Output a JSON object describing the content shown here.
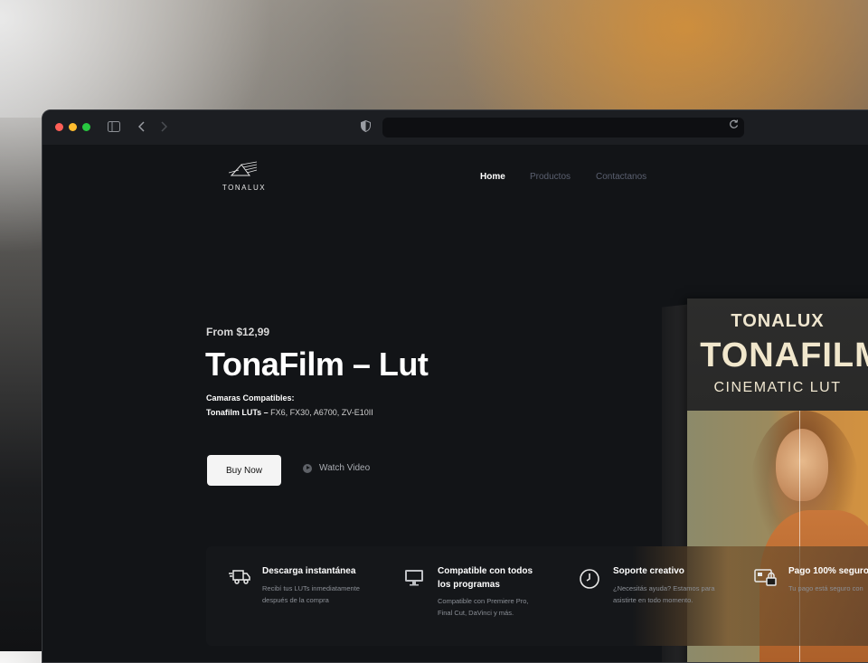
{
  "site": {
    "logo_text": "TONALUX",
    "nav": {
      "home": "Home",
      "products": "Productos",
      "contact": "Contactanos"
    }
  },
  "hero": {
    "price": "From $12,99",
    "title": "TonaFilm – Lut",
    "compat_label": "Camaras Compatibles:",
    "compat_bold": "Tonafilm LUTs –",
    "compat_models": " FX6, FX30, A6700, ZV-E10II",
    "buy_label": "Buy Now",
    "watch_label": "Watch Video"
  },
  "product_box": {
    "brand": "TONALUX",
    "title": "TONAFILM",
    "subtitle": "CINEMATIC LUT"
  },
  "features": [
    {
      "icon": "delivery-truck-icon",
      "title": "Descarga instantánea",
      "desc1": "Recibí tus LUTs inmediatamente",
      "desc2": "después de la compra"
    },
    {
      "icon": "monitor-icon",
      "title1": "Compatible con todos",
      "title2": "los programas",
      "desc1": "Compatible con Premiere Pro,",
      "desc2": "Final Cut, DaVinci y más."
    },
    {
      "icon": "clock-icon",
      "title": "Soporte creativo",
      "desc1": "¿Necesitás ayuda? Estamos para",
      "desc2": "asistirte en todo momento."
    },
    {
      "icon": "secure-payment-icon",
      "title": "Pago 100% seguro",
      "desc1": "Tu pago está seguro con"
    }
  ]
}
